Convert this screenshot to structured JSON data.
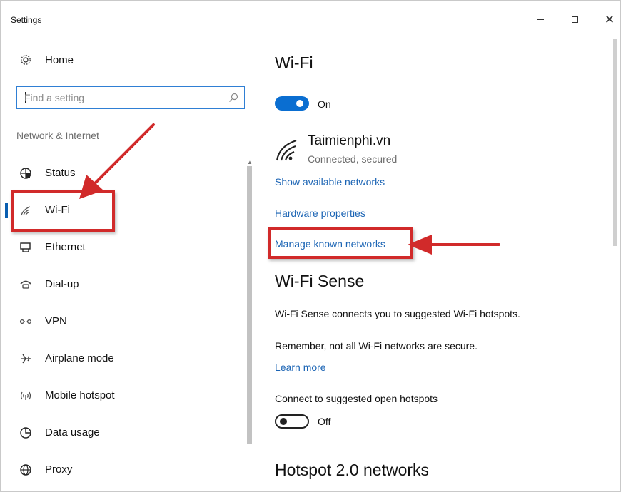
{
  "window": {
    "title": "Settings"
  },
  "sidebar": {
    "home_label": "Home",
    "search_placeholder": "Find a setting",
    "section_header": "Network & Internet",
    "items": [
      {
        "label": "Status",
        "icon": "globe-status-icon"
      },
      {
        "label": "Wi-Fi",
        "icon": "wifi-icon",
        "selected": true
      },
      {
        "label": "Ethernet",
        "icon": "ethernet-icon"
      },
      {
        "label": "Dial-up",
        "icon": "dialup-phone-icon"
      },
      {
        "label": "VPN",
        "icon": "vpn-icon"
      },
      {
        "label": "Airplane mode",
        "icon": "airplane-icon"
      },
      {
        "label": "Mobile hotspot",
        "icon": "mobile-hotspot-icon"
      },
      {
        "label": "Data usage",
        "icon": "data-usage-pie-icon"
      },
      {
        "label": "Proxy",
        "icon": "proxy-globe-icon"
      }
    ]
  },
  "main": {
    "title": "Wi-Fi",
    "wifi_toggle": {
      "state": "On",
      "on": true
    },
    "network": {
      "name": "Taimienphi.vn",
      "status": "Connected, secured"
    },
    "links": {
      "show_networks": "Show available networks",
      "hardware": "Hardware properties",
      "manage_known": "Manage known networks"
    },
    "sense": {
      "title": "Wi-Fi Sense",
      "description": "Wi-Fi Sense connects you to suggested Wi-Fi hotspots.",
      "warning": "Remember, not all Wi-Fi networks are secure.",
      "learn_more": "Learn more",
      "connect_label": "Connect to suggested open hotspots",
      "toggle_state": "Off",
      "toggle_on": false
    },
    "hotspot_title": "Hotspot 2.0 networks"
  },
  "colors": {
    "accent": "#0a6ed1",
    "link": "#1b64b4",
    "annotation": "#d12a2a",
    "selection_bar": "#0a5eb0"
  }
}
